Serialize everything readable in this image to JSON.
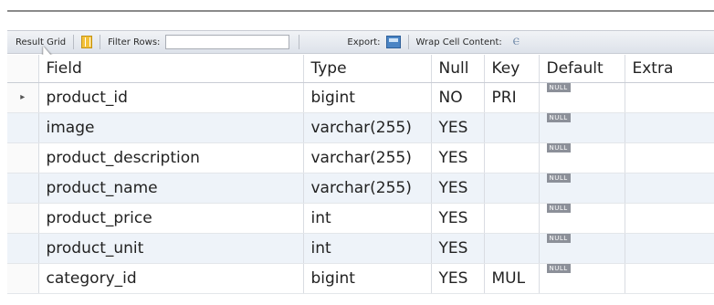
{
  "toolbar": {
    "result_grid_label": "Result Grid",
    "filter_rows_label": "Filter Rows:",
    "filter_value": "",
    "export_label": "Export:",
    "wrap_label": "Wrap Cell Content:",
    "wrap_icon": "Ⲉ"
  },
  "columns": [
    "Field",
    "Type",
    "Null",
    "Key",
    "Default",
    "Extra"
  ],
  "rows": [
    {
      "field": "product_id",
      "type": "bigint",
      "null": "NO",
      "key": "PRI",
      "default": "NULL",
      "extra": "",
      "indicator": "▸"
    },
    {
      "field": "image",
      "type": "varchar(255)",
      "null": "YES",
      "key": "",
      "default": "NULL",
      "extra": "",
      "indicator": ""
    },
    {
      "field": "product_description",
      "type": "varchar(255)",
      "null": "YES",
      "key": "",
      "default": "NULL",
      "extra": "",
      "indicator": ""
    },
    {
      "field": "product_name",
      "type": "varchar(255)",
      "null": "YES",
      "key": "",
      "default": "NULL",
      "extra": "",
      "indicator": ""
    },
    {
      "field": "product_price",
      "type": "int",
      "null": "YES",
      "key": "",
      "default": "NULL",
      "extra": "",
      "indicator": ""
    },
    {
      "field": "product_unit",
      "type": "int",
      "null": "YES",
      "key": "",
      "default": "NULL",
      "extra": "",
      "indicator": ""
    },
    {
      "field": "category_id",
      "type": "bigint",
      "null": "YES",
      "key": "MUL",
      "default": "NULL",
      "extra": "",
      "indicator": ""
    }
  ]
}
